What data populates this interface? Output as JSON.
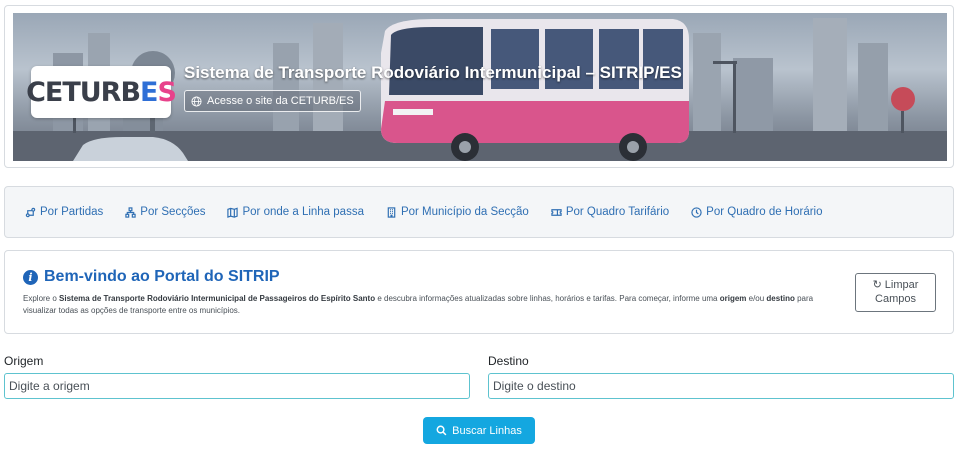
{
  "header": {
    "logo": {
      "part1": "CETURB",
      "part2": "E",
      "part3": "S"
    },
    "title": "Sistema de Transporte Rodoviário Intermunicipal – SITRIP/ES",
    "site_link_label": "Acesse o site da CETURB/ES"
  },
  "nav": {
    "items": [
      {
        "label": "Por Partidas",
        "icon": "route-icon"
      },
      {
        "label": "Por Secções",
        "icon": "sitemap-icon"
      },
      {
        "label": "Por onde a Linha passa",
        "icon": "map-icon"
      },
      {
        "label": "Por Município da Secção",
        "icon": "building-icon"
      },
      {
        "label": "Por Quadro Tarifário",
        "icon": "ticket-icon"
      },
      {
        "label": "Por Quadro de Horário",
        "icon": "clock-icon"
      }
    ]
  },
  "welcome": {
    "title": "Bem-vindo ao Portal do SITRIP",
    "text_1": "Explore o ",
    "text_bold_1": "Sistema de Transporte Rodoviário Intermunicipal de Passageiros do Espírito Santo",
    "text_2": " e descubra informações atualizadas sobre linhas, horários e tarifas. Para começar, informe uma ",
    "text_bold_2": "origem",
    "text_3": " e/ou ",
    "text_bold_3": "destino",
    "text_4": " para visualizar todas as opções de transporte entre os municípios.",
    "clear_label_1": "Limpar",
    "clear_label_2": "Campos"
  },
  "form": {
    "origin_label": "Origem",
    "origin_placeholder": "Digite a origem",
    "origin_value": "",
    "destination_label": "Destino",
    "destination_placeholder": "Digite o destino",
    "destination_value": "",
    "search_label": "Buscar Linhas"
  },
  "colors": {
    "primary_blue": "#1f65b8",
    "nav_link": "#2f6fb3",
    "search_button": "#14a7e0",
    "input_border": "#5ec3cf",
    "logo_pink": "#e8428b"
  }
}
